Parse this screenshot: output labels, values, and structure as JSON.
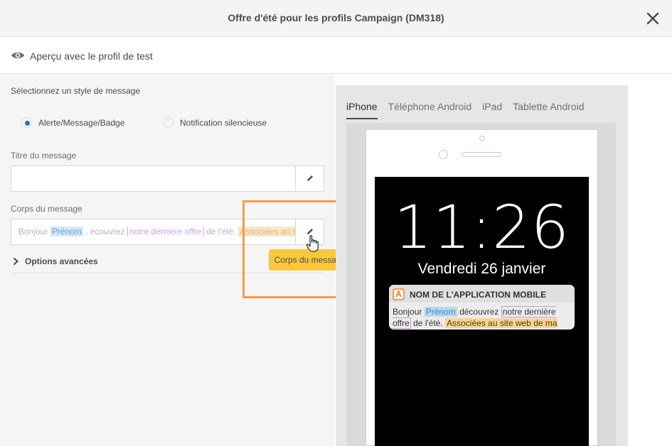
{
  "window": {
    "title": "Offre d'été pour les profils Campaign (DM318)"
  },
  "preview": {
    "label": "Aperçu avec le profil de test"
  },
  "form": {
    "style_title": "Sélectionnez un style de message",
    "radio_alert": "Alerte/Message/Badge",
    "radio_silent": "Notification silencieuse",
    "selected_style": "Alerte/Message/Badge",
    "title_label": "Titre du message",
    "title_value": "",
    "body_label": "Corps du message",
    "body": {
      "t1": "Bonjour ",
      "tok_firstname": "Prénom",
      "t2": " , écouvrez ",
      "tok_offer": "notre dernière offre",
      "t3": " de l'été. ",
      "tok_partners": "Associées au site"
    },
    "advanced_label": "Options avancées",
    "tooltip": "Corps du message"
  },
  "devices": {
    "tabs": [
      "iPhone",
      "Téléphone Android",
      "iPad",
      "Tablette Android"
    ],
    "active": "iPhone"
  },
  "phone": {
    "time": "11:26",
    "date": "Vendredi 26 janvier",
    "app_icon_letter": "A",
    "app_name": "NOM DE L'APPLICATION MOBILE",
    "notif": {
      "t1": "Bonjour ",
      "tok_firstname": "Prénom",
      "t2": " découvrez ",
      "tok_offer": "notre dernière offre",
      "t3": " de l'été. ",
      "tok_partners": "Associées au site web de ma marque",
      "t4": " !"
    }
  },
  "colors": {
    "accent_blue": "#2d6ec9",
    "highlight_orange": "#f39c4b",
    "tooltip_yellow": "#fbc73c"
  }
}
